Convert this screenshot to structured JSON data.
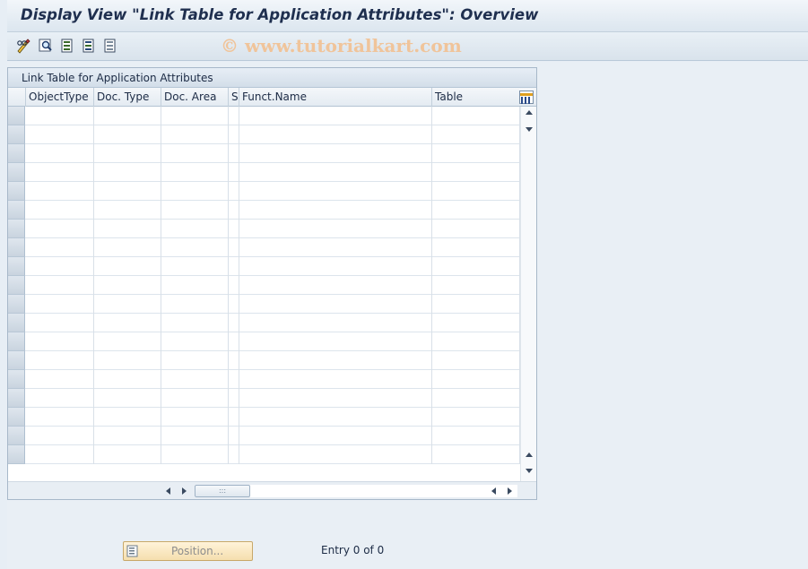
{
  "window": {
    "title": "Display View \"Link Table for Application Attributes\": Overview",
    "watermark": "© www.tutorialkart.com"
  },
  "toolbar": {
    "buttons": [
      {
        "name": "display-change-icon"
      },
      {
        "name": "find-icon"
      },
      {
        "name": "select-all-icon"
      },
      {
        "name": "select-block-icon"
      },
      {
        "name": "deselect-all-icon"
      }
    ]
  },
  "table": {
    "title": "Link Table for Application Attributes",
    "columns": [
      "ObjectType",
      "Doc. Type",
      "Doc. Area",
      "S",
      "Funct.Name",
      "Table"
    ],
    "rows": []
  },
  "footer": {
    "position_label": "Position...",
    "entry_text": "Entry 0 of 0"
  }
}
